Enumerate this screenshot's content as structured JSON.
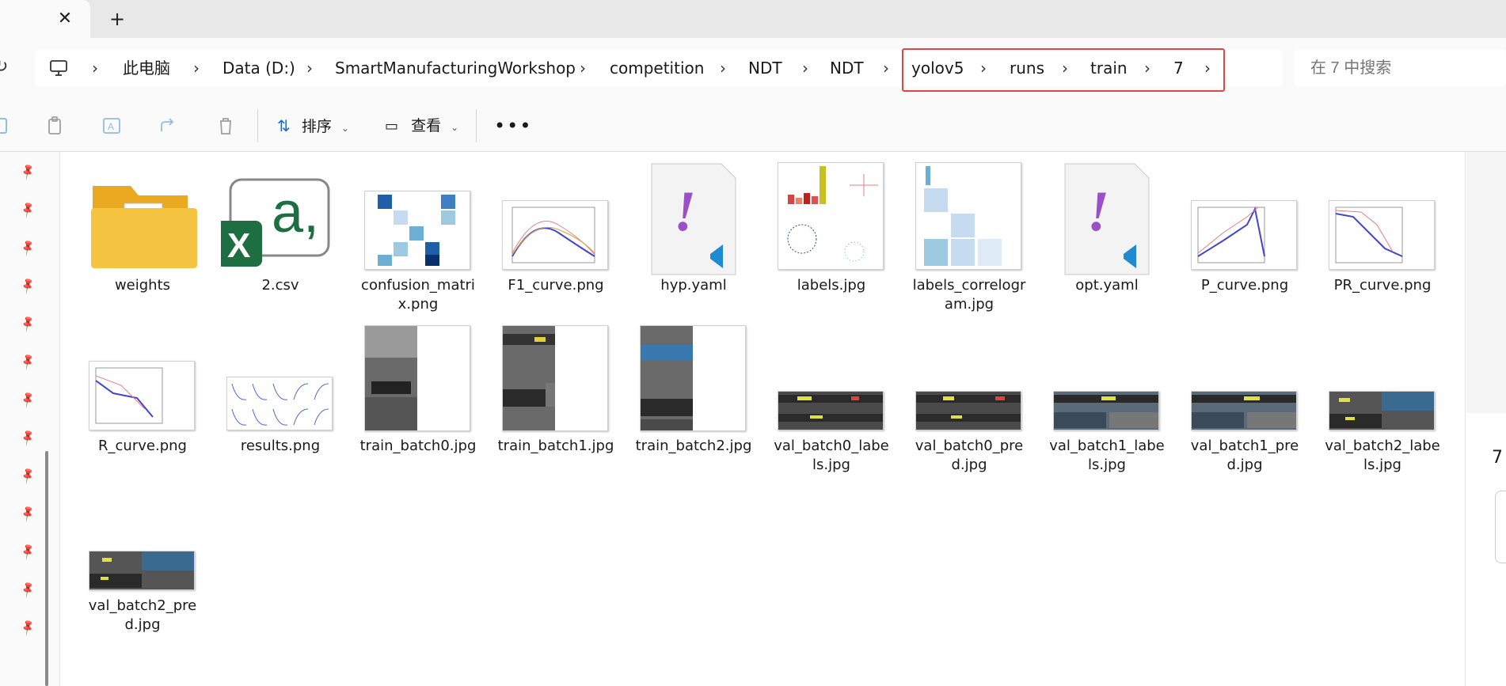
{
  "window": {
    "tab_close_icon": "close-icon",
    "new_tab_icon": "plus-icon"
  },
  "breadcrumb": {
    "items": [
      "此电脑",
      "Data (D:)",
      "SmartManufacturingWorkshop",
      "competition",
      "NDT",
      "NDT",
      "yolov5",
      "runs",
      "train",
      "7"
    ],
    "highlight_color": "#e24545"
  },
  "search": {
    "placeholder": "在 7 中搜索"
  },
  "toolbar": {
    "sort_label": "排序",
    "view_label": "查看",
    "more_label": "•••"
  },
  "files": [
    {
      "name": "weights",
      "type": "folder"
    },
    {
      "name": "2.csv",
      "type": "csv"
    },
    {
      "name": "confusion_matrix.png",
      "type": "image"
    },
    {
      "name": "F1_curve.png",
      "type": "image"
    },
    {
      "name": "hyp.yaml",
      "type": "yaml"
    },
    {
      "name": "labels.jpg",
      "type": "image"
    },
    {
      "name": "labels_correlogram.jpg",
      "type": "image"
    },
    {
      "name": "opt.yaml",
      "type": "yaml"
    },
    {
      "name": "P_curve.png",
      "type": "image"
    },
    {
      "name": "PR_curve.png",
      "type": "image"
    },
    {
      "name": "R_curve.png",
      "type": "image"
    },
    {
      "name": "results.png",
      "type": "image"
    },
    {
      "name": "train_batch0.jpg",
      "type": "image"
    },
    {
      "name": "train_batch1.jpg",
      "type": "image"
    },
    {
      "name": "train_batch2.jpg",
      "type": "image"
    },
    {
      "name": "val_batch0_labels.jpg",
      "type": "image"
    },
    {
      "name": "val_batch0_pred.jpg",
      "type": "image"
    },
    {
      "name": "val_batch1_labels.jpg",
      "type": "image"
    },
    {
      "name": "val_batch1_pred.jpg",
      "type": "image"
    },
    {
      "name": "val_batch2_labels.jpg",
      "type": "image"
    },
    {
      "name": "val_batch2_pred.jpg",
      "type": "image"
    }
  ],
  "details_panel": {
    "item_count": "7"
  },
  "colors": {
    "folder": "#f5c542",
    "excel_green": "#1d6f42",
    "vscode_purple": "#9b4fc8",
    "vscode_blue": "#1f8ad2"
  }
}
